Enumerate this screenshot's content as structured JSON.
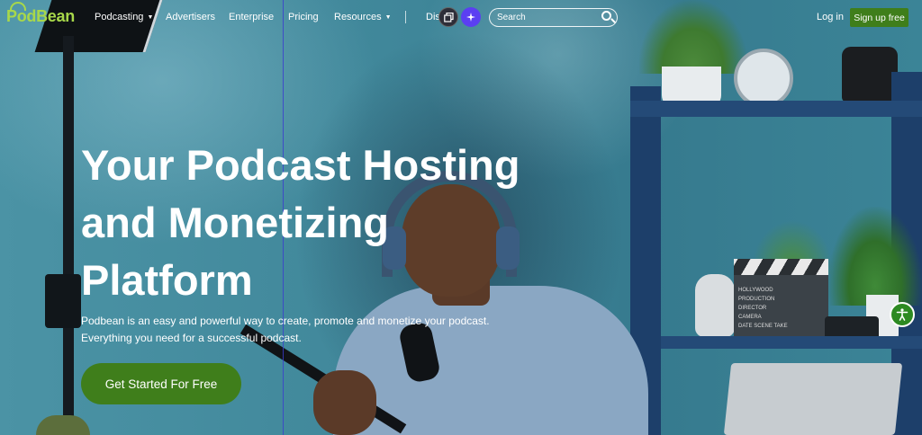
{
  "brand": {
    "logo_text": "PodBean",
    "accent": "#a8d84a",
    "button_green": "#3f7e1b"
  },
  "nav": {
    "items": [
      {
        "label": "Podcasting",
        "has_dropdown": true
      },
      {
        "label": "Advertisers",
        "has_dropdown": false
      },
      {
        "label": "Enterprise",
        "has_dropdown": false
      },
      {
        "label": "Pricing",
        "has_dropdown": false
      },
      {
        "label": "Resources",
        "has_dropdown": true
      },
      {
        "label": "Disc",
        "has_dropdown": false
      }
    ],
    "search_placeholder": "Search",
    "login_label": "Log in",
    "signup_label": "Sign up free"
  },
  "hero": {
    "title_line1": "Your Podcast Hosting",
    "title_line2": "and Monetizing",
    "title_line3": "Platform",
    "subtitle": "Podbean is an easy and powerful way to create, promote and monetize your podcast. Everything you need for a successful podcast.",
    "cta_label": "Get Started For Free"
  },
  "scene": {
    "clapper_lines": [
      "HOLLYWOOD",
      "PRODUCTION",
      "DIRECTOR",
      "CAMERA",
      "DATE   SCENE   TAKE"
    ]
  },
  "icons": {
    "copy": "copy-icon",
    "sparkle": "sparkle-icon",
    "search": "search-icon",
    "accessibility": "accessibility-icon"
  }
}
